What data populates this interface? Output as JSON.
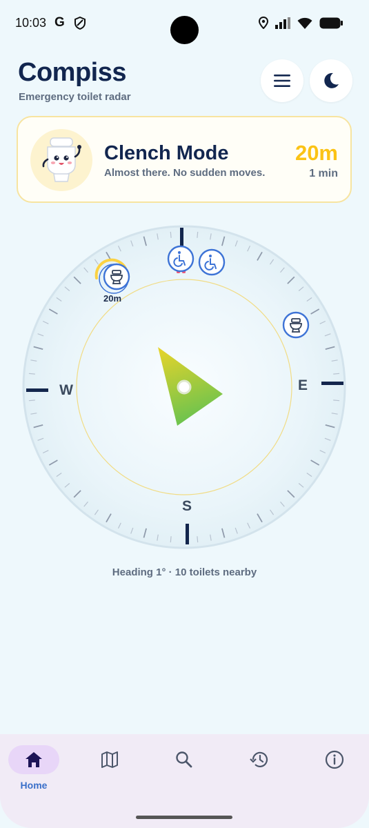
{
  "status_bar": {
    "time": "10:03",
    "g_label": "G",
    "icons": [
      "shield-icon",
      "location-icon",
      "signal-icon",
      "wifi-icon",
      "battery-icon"
    ]
  },
  "header": {
    "title": "Compiss",
    "subtitle": "Emergency toilet radar",
    "menu_icon": "hamburger-menu-icon",
    "theme_icon": "moon-icon"
  },
  "mode_card": {
    "title": "Clench Mode",
    "subtitle": "Almost there. No sudden moves.",
    "distance": "20m",
    "eta": "1 min",
    "mascot_icon": "toilet-mascot-icon",
    "accent_color": "#fbc316",
    "border_color": "#f7e4a0"
  },
  "compass": {
    "directions": {
      "west": "W",
      "east": "E",
      "south": "S"
    },
    "nearest_marker_label": "20m",
    "markers": [
      {
        "icon": "accessible-icon",
        "kind": "accessible"
      },
      {
        "icon": "accessible-icon",
        "kind": "accessible"
      },
      {
        "icon": "toilet-icon",
        "kind": "toilet",
        "nearest": true
      },
      {
        "icon": "toilet-icon",
        "kind": "toilet"
      }
    ],
    "arrow_colors": [
      "#e9d42a",
      "#6cc34e"
    ],
    "marker_color": "#3d73d6"
  },
  "footer": {
    "heading_text": "Heading 1° · 10 toilets nearby"
  },
  "bottom_nav": {
    "items": [
      {
        "label": "Home",
        "icon": "home-icon",
        "active": true
      },
      {
        "label": "",
        "icon": "map-icon",
        "active": false
      },
      {
        "label": "",
        "icon": "search-icon",
        "active": false
      },
      {
        "label": "",
        "icon": "history-icon",
        "active": false
      },
      {
        "label": "",
        "icon": "info-icon",
        "active": false
      }
    ]
  }
}
